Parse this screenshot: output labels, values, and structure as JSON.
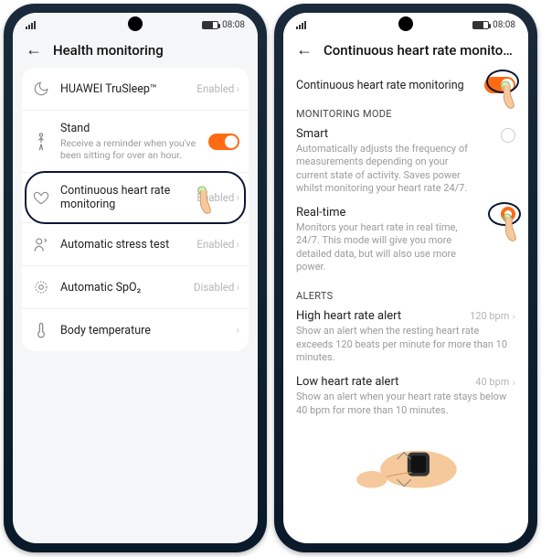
{
  "status": {
    "time": "08:08"
  },
  "left": {
    "title": "Health monitoring",
    "items": [
      {
        "icon": "moon",
        "label": "HUAWEI TruSleep™",
        "status": "Enabled"
      },
      {
        "icon": "stand",
        "label": "Stand",
        "desc": "Receive a reminder when you've been sitting for over an hour.",
        "toggle": true
      },
      {
        "icon": "heart",
        "label": "Continuous heart rate monitoring",
        "status": "Enabled",
        "highlighted": true
      },
      {
        "icon": "stress",
        "label": "Automatic stress test",
        "status": "Enabled"
      },
      {
        "icon": "spo2",
        "label": "Automatic SpO₂",
        "status": "Disabled"
      },
      {
        "icon": "temp",
        "label": "Body temperature",
        "status": ""
      }
    ]
  },
  "right": {
    "title": "Continuous heart rate monitoring",
    "toggle_label": "Continuous heart rate monitoring",
    "mode_section": "MONITORING MODE",
    "options": [
      {
        "title": "Smart",
        "desc": "Automatically adjusts the frequency of measurements depending on your current state of activity. Saves power whilst monitoring your heart rate 24/7.",
        "selected": false
      },
      {
        "title": "Real-time",
        "desc": "Monitors your heart rate in real time, 24/7. This mode will give you more detailed data, but will also use more power.",
        "selected": true,
        "highlighted": true
      }
    ],
    "alerts_section": "ALERTS",
    "alerts": [
      {
        "title": "High heart rate alert",
        "value": "120 bpm",
        "desc": "Show an alert when the resting heart rate exceeds 120 beats per minute for more than 10 minutes."
      },
      {
        "title": "Low heart rate alert",
        "value": "40 bpm",
        "desc": "Show an alert when your heart rate stays below 40 bpm for more than 10 minutes."
      }
    ]
  }
}
